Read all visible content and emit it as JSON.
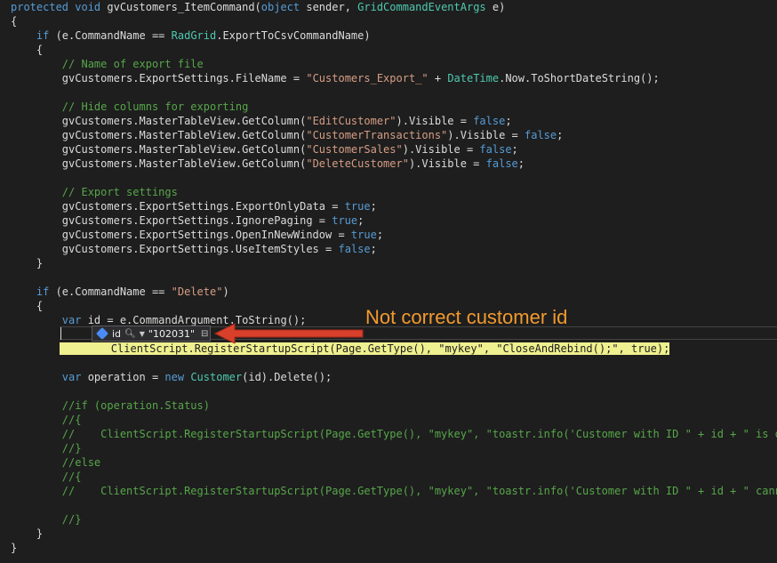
{
  "code": {
    "l1": {
      "p1": "protected void ",
      "p2": "gvCustomers_ItemCommand(",
      "p3": "object",
      "p4": " sender, ",
      "p5": "GridCommandEventArgs",
      "p6": " e)"
    },
    "l2": "{",
    "l3": {
      "p1": "    if",
      "p2": " (e.CommandName == ",
      "p3": "RadGrid",
      "p4": ".ExportToCsvCommandName)"
    },
    "l4": "    {",
    "l5": "        // Name of export file",
    "l6": {
      "p1": "        gvCustomers.ExportSettings.FileName = ",
      "p2": "\"Customers_Export_\"",
      "p3": " + ",
      "p4": "DateTime",
      "p5": ".Now.ToShortDateString();"
    },
    "l7": "        // Hide columns for exporting",
    "l8": {
      "p1": "        gvCustomers.MasterTableView.GetColumn(",
      "p2": "\"EditCustomer\"",
      "p3": ").Visible = ",
      "p4": "false",
      "p5": ";"
    },
    "l9": {
      "p1": "        gvCustomers.MasterTableView.GetColumn(",
      "p2": "\"CustomerTransactions\"",
      "p3": ").Visible = ",
      "p4": "false",
      "p5": ";"
    },
    "l10": {
      "p1": "        gvCustomers.MasterTableView.GetColumn(",
      "p2": "\"CustomerSales\"",
      "p3": ").Visible = ",
      "p4": "false",
      "p5": ";"
    },
    "l11": {
      "p1": "        gvCustomers.MasterTableView.GetColumn(",
      "p2": "\"DeleteCustomer\"",
      "p3": ").Visible = ",
      "p4": "false",
      "p5": ";"
    },
    "l12": "        // Export settings",
    "l13": {
      "p1": "        gvCustomers.ExportSettings.ExportOnlyData = ",
      "p2": "true",
      "p3": ";"
    },
    "l14": {
      "p1": "        gvCustomers.ExportSettings.IgnorePaging = ",
      "p2": "true",
      "p3": ";"
    },
    "l15": {
      "p1": "        gvCustomers.ExportSettings.OpenInNewWindow = ",
      "p2": "true",
      "p3": ";"
    },
    "l16": {
      "p1": "        gvCustomers.ExportSettings.UseItemStyles = ",
      "p2": "false",
      "p3": ";"
    },
    "l17": "    }",
    "l18": {
      "p1": "    if",
      "p2": " (e.CommandName == ",
      "p3": "\"Delete\"",
      "p4": ")"
    },
    "l19": "    {",
    "l20": {
      "p1": "        var",
      "p2": " id = e.CommandArgument.ToString();"
    },
    "l21": {
      "p1": "        ClientScript.RegisterStartupScript(Page.GetType(), \"mykey\", \"CloseAndRebind();\", true);"
    },
    "l22": {
      "p1": "        var",
      "p2": " operation = ",
      "p3": "new",
      "p4": " ",
      "p5": "Customer",
      "p6": "(id).Delete();"
    },
    "l23": "        //if (operation.Status)",
    "l24": "        //{",
    "l25": "        //    ClientScript.RegisterStartupScript(Page.GetType(), \"mykey\", \"toastr.info('Customer with ID \" + id + \" is dele",
    "l26": "        //}",
    "l27": "        //else",
    "l28": "        //{",
    "l29": "        //    ClientScript.RegisterStartupScript(Page.GetType(), \"mykey\", \"toastr.info('Customer with ID \" + id + \" cannot",
    "l30": "        //}",
    "l31": "    }",
    "l32": "}"
  },
  "datatip": {
    "name": "id",
    "value": "\"102031\"",
    "icons": {
      "var": "field-icon",
      "search": "magnifier-icon",
      "expand": "chevron-down-icon",
      "pin": "pin-icon"
    }
  },
  "annotation": {
    "text": "Not correct customer id",
    "color": "#f39a2d"
  },
  "colors": {
    "background": "#1e1e1e",
    "keyword": "#569cd6",
    "type": "#4ec9b0",
    "string": "#d69d85",
    "comment": "#57a64a",
    "highlight": "#eff08f"
  }
}
